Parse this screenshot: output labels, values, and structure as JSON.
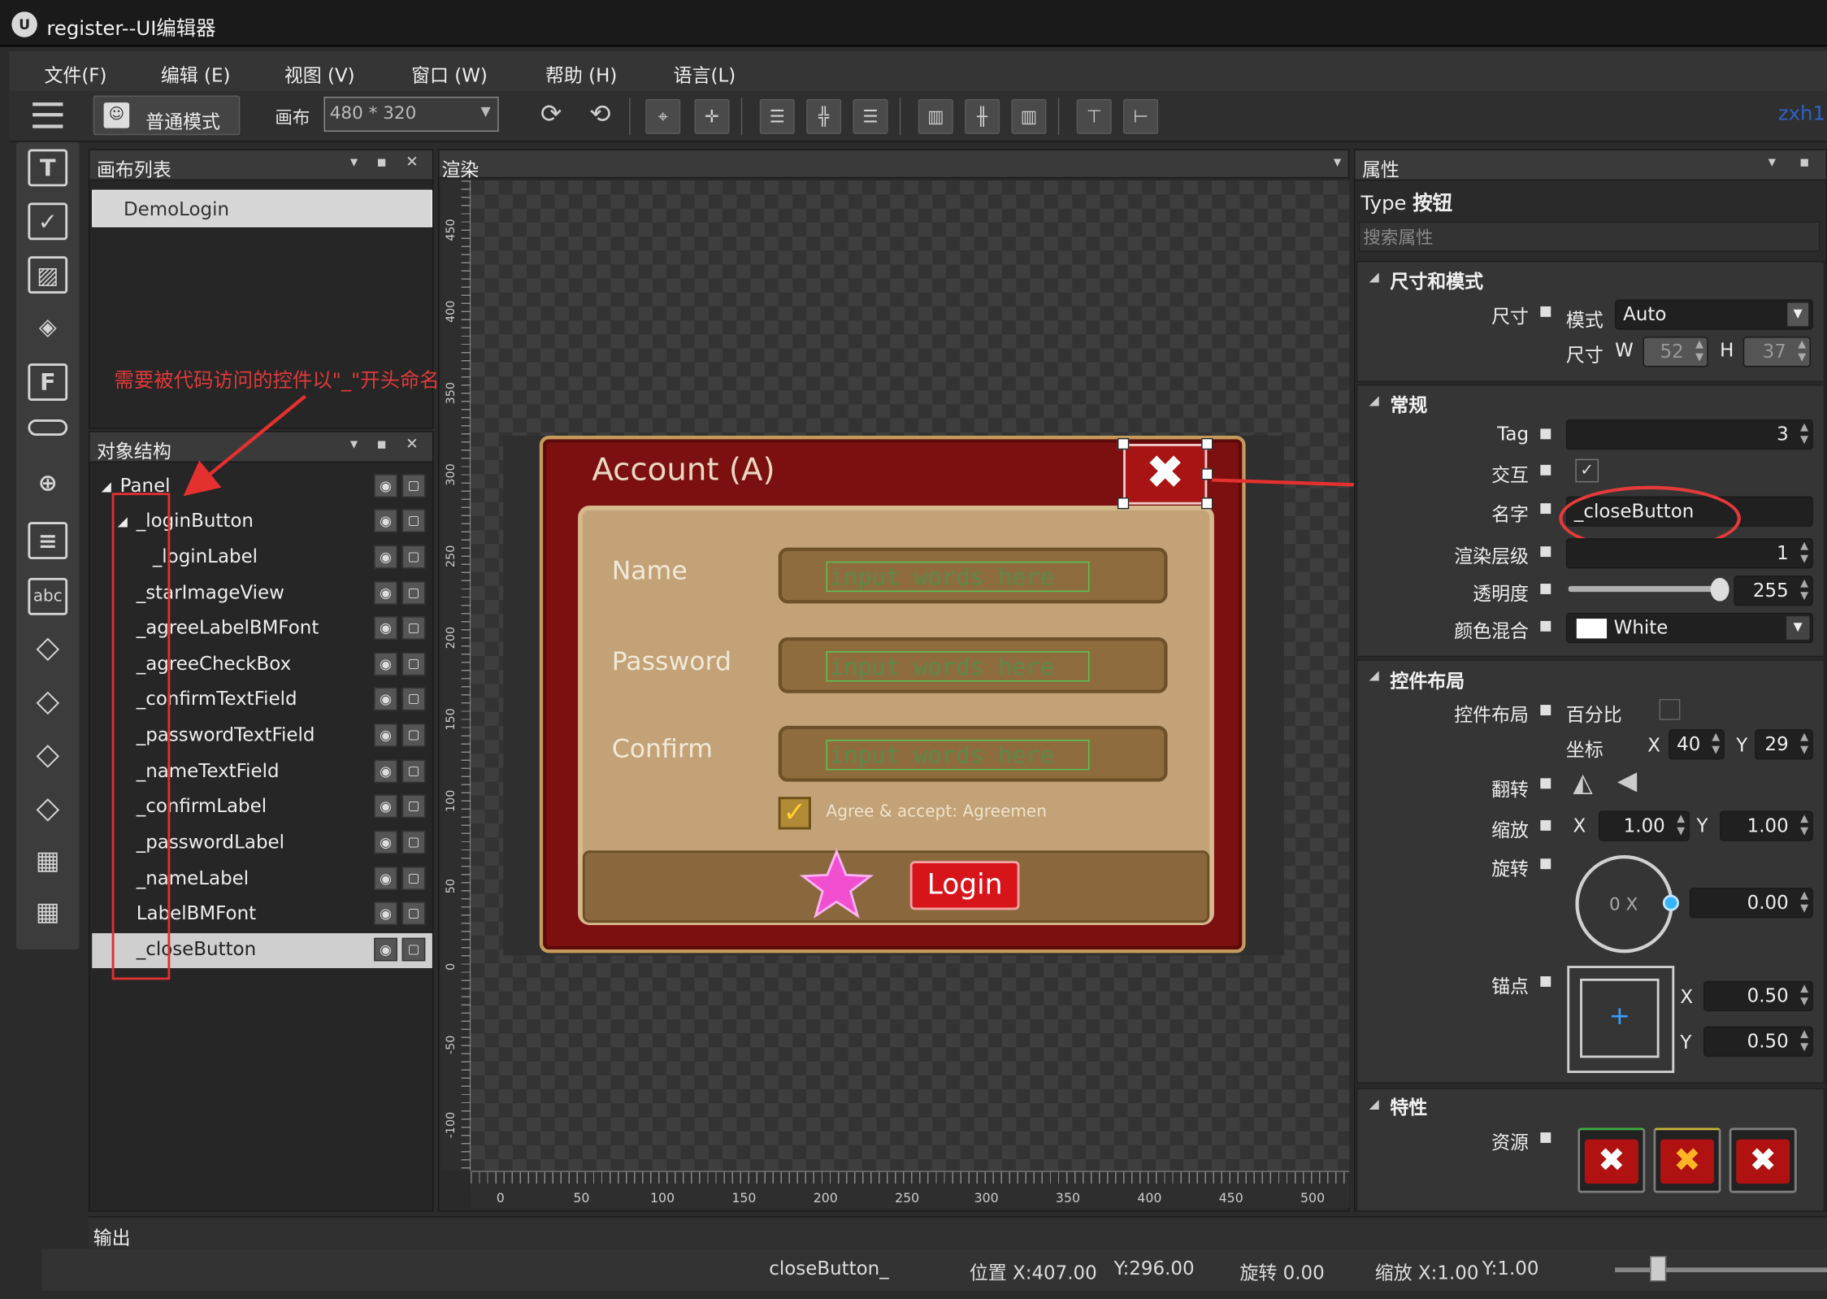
{
  "window": {
    "title": "register--UI编辑器",
    "user": "zxh1"
  },
  "menu": [
    "文件(F)",
    "编辑 (E)",
    "视图 (V)",
    "窗口 (W)",
    "帮助 (H)",
    "语言(L)"
  ],
  "toolbar": {
    "mode_label": "普通模式",
    "canvas_label": "画布",
    "canvas_size": "480 * 320"
  },
  "canvas_list": {
    "title": "画布列表",
    "items": [
      "DemoLogin"
    ]
  },
  "annotation": "需要被代码访问的控件以\"_\"开头命名",
  "object_tree": {
    "title": "对象结构",
    "items": [
      "Panel",
      "_loginButton",
      "_loginLabel",
      "_starImageView",
      "_agreeLabelBMFont",
      "_agreeCheckBox",
      "_confirmTextField",
      "_passwordTextField",
      "_nameTextField",
      "_confirmLabel",
      "_passwordLabel",
      "_nameLabel",
      "LabelBMFont",
      "_closeButton"
    ]
  },
  "render": {
    "title": "渲染",
    "v_ticks": [
      "450",
      "400",
      "350",
      "300",
      "250",
      "200",
      "150",
      "100",
      "50",
      "0",
      "-50",
      "-100"
    ],
    "h_ticks": [
      "0",
      "50",
      "100",
      "150",
      "200",
      "250",
      "300",
      "350",
      "400",
      "450",
      "500"
    ],
    "dialog": {
      "title": "Account (A)",
      "name_label": "Name",
      "password_label": "Password",
      "confirm_label": "Confirm",
      "placeholder": "input words here",
      "agree_text": "Agree & accept: Agreemen",
      "login_label": "Login"
    }
  },
  "properties": {
    "title": "属性",
    "type_label": "Type",
    "type_value": "按钮",
    "search_placeholder": "搜索属性",
    "size_section": {
      "title": "尺寸和模式",
      "size_label": "尺寸",
      "mode_label": "模式",
      "mode_value": "Auto",
      "size2_label": "尺寸",
      "w_label": "W",
      "w_value": "52",
      "h_label": "H",
      "h_value": "37"
    },
    "general_section": {
      "title": "常规",
      "tag_label": "Tag",
      "tag_value": "3",
      "interact_label": "交互",
      "name_label": "名字",
      "name_value": "_closeButton",
      "zorder_label": "渲染层级",
      "zorder_value": "1",
      "opacity_label": "透明度",
      "opacity_value": "255",
      "blend_label": "颜色混合",
      "blend_value": "White"
    },
    "layout_section": {
      "title": "控件布局",
      "layout_label": "控件布局",
      "percent_label": "百分比",
      "pos_label": "坐标",
      "x_label": "X",
      "x_value": "40",
      "y_label": "Y",
      "y_value": "29",
      "flip_label": "翻转",
      "scale_label": "缩放",
      "scale_x": "1.00",
      "scale_y": "1.00",
      "rotate_label": "旋转",
      "rotate_dial": "0 X",
      "rotate_value": "0.00",
      "anchor_label": "锚点",
      "anchor_x": "0.50",
      "anchor_y": "0.50"
    },
    "feature_section": {
      "title": "特性",
      "resource_label": "资源"
    }
  },
  "output": {
    "title": "输出"
  },
  "status": {
    "name": "closeButton_",
    "position": "位置 X:407.00",
    "position_y": "Y:296.00",
    "rotation": "旋转 0.00",
    "scale": "缩放 X:1.00",
    "scale_y": "Y:1.00"
  }
}
